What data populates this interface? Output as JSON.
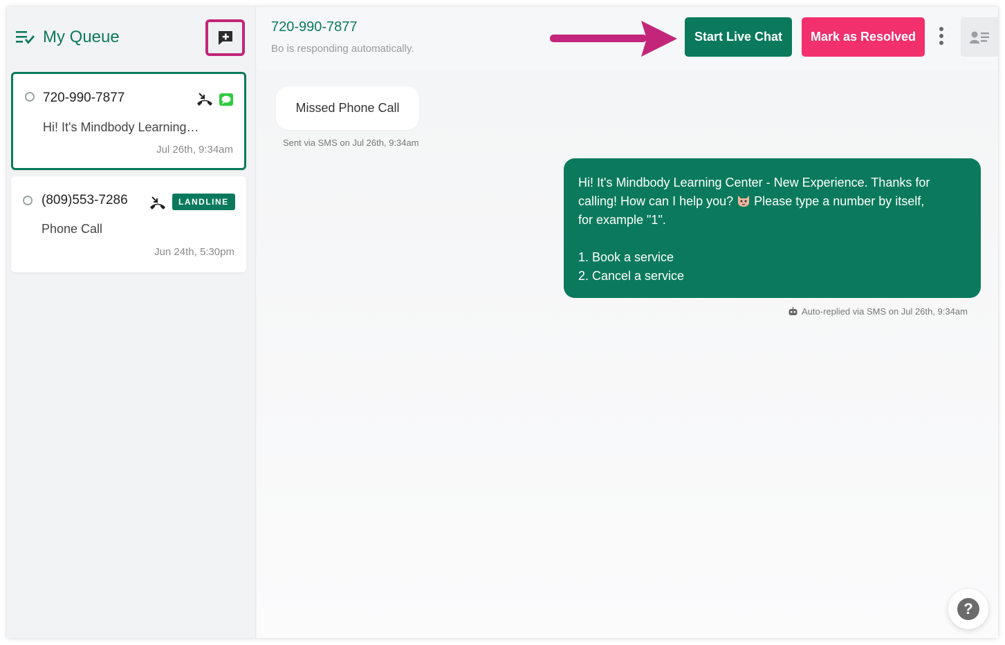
{
  "sidebar": {
    "title": "My Queue",
    "conversations": [
      {
        "phone": "720-990-7877",
        "preview": "Hi! It's Mindbody Learning…",
        "time": "Jul 26th, 9:34am",
        "call_icon": "missed-call-icon",
        "channel_icon": "sms-chat-icon"
      },
      {
        "phone": "(809)553-7286",
        "preview": "Phone Call",
        "time": "Jun 24th, 5:30pm",
        "call_icon": "missed-call-icon",
        "badge": "LANDLINE"
      }
    ]
  },
  "header": {
    "phone": "720-990-7877",
    "status": "Bo is responding automatically.",
    "start_live_chat": "Start Live Chat",
    "mark_resolved": "Mark as Resolved"
  },
  "messages": {
    "incoming": {
      "text": "Missed Phone Call",
      "meta": "Sent via SMS on Jul 26th, 9:34am"
    },
    "outgoing": {
      "line1": "Hi! It's Mindbody Learning Center - New Experience. Thanks for",
      "line2a": "calling! How can I help you?",
      "line2b": "Please type a number by itself,",
      "line3": "for example \"1\".",
      "option1": "1. Book a service",
      "option2": "2. Cancel a service",
      "meta": "Auto-replied via SMS on Jul 26th, 9:34am"
    }
  },
  "colors": {
    "brand_green": "#0b7a5c",
    "resolve_pink": "#f2306e",
    "highlight_magenta": "#c2257a",
    "sms_green": "#2ecc40"
  },
  "help_label": "?"
}
